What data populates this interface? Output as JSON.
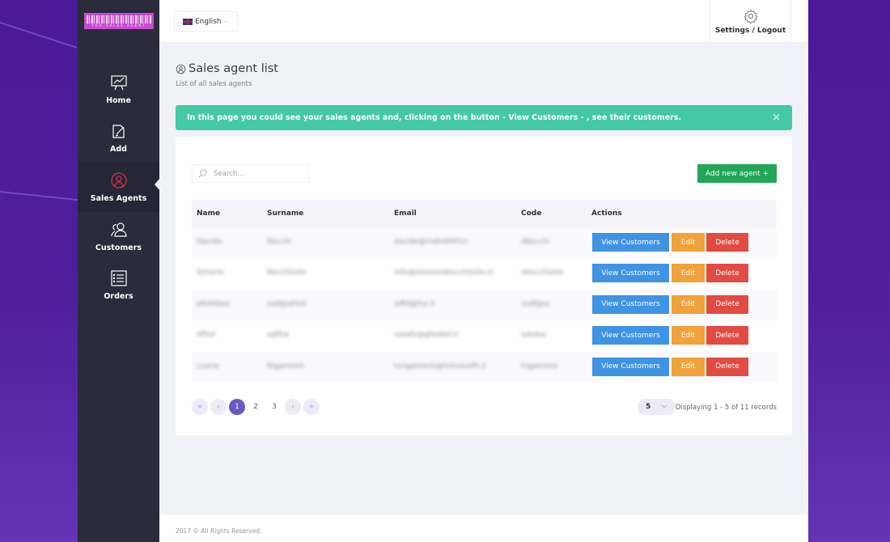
{
  "logo": {
    "text": "YOO SALES AGENT"
  },
  "topbar": {
    "language": "English",
    "settings_label": "Settings / Logout"
  },
  "sidebar": {
    "items": [
      {
        "label": "Home",
        "icon": "presentation-chart-icon",
        "active": false
      },
      {
        "label": "Add",
        "icon": "edit-document-icon",
        "active": false
      },
      {
        "label": "Sales Agents",
        "icon": "agent-globe-icon",
        "active": true
      },
      {
        "label": "Customers",
        "icon": "users-icon",
        "active": false
      },
      {
        "label": "Orders",
        "icon": "list-icon",
        "active": false
      }
    ]
  },
  "page": {
    "title": "Sales agent list",
    "subtitle": "List of all sales agents"
  },
  "alert": {
    "text": "In this page you could see your sales agents and, clicking on the button - View Customers - , see their customers.",
    "close": "×"
  },
  "toolbar": {
    "search_placeholder": "Search...",
    "add_label": "Add new agent +"
  },
  "table": {
    "headers": {
      "name": "Name",
      "surname": "Surname",
      "email": "Email",
      "code": "Code",
      "actions": "Actions"
    },
    "rows": [
      {
        "name": "Davide",
        "surname": "Bocchi",
        "email": "davide@rndm0001n",
        "code": "dbocchi"
      },
      {
        "name": "Simone",
        "surname": "Bocchisola",
        "email": "info@simoneabocchisola.ct",
        "code": "sbocchisola"
      },
      {
        "name": "Jdtdldaso",
        "surname": "sadqsahsd",
        "email": "sdfd@fsa.it",
        "code": "sodfgsa"
      },
      {
        "name": "dffsd",
        "surname": "sqffsa",
        "email": "sasafs@gfeddsf.it",
        "code": "sdsdsa"
      },
      {
        "name": "Luana",
        "surname": "Rigamonti",
        "email": "lurigamonti@tolinosefit.it",
        "code": "lrigamonti"
      }
    ],
    "actions": {
      "view": "View Customers",
      "edit": "Edit",
      "delete": "Delete"
    }
  },
  "pagination": {
    "first": "«",
    "prev": "‹",
    "pages": [
      "1",
      "2",
      "3"
    ],
    "current": "1",
    "next": "›",
    "last": "»",
    "page_size": "5",
    "display": "Displaying 1 - 5 of 11 records"
  },
  "footer": {
    "text": "2017 © All Rights Reserved."
  },
  "colors": {
    "accent": "#6c58c5",
    "success": "#22a657",
    "alert": "#44c8a6",
    "view": "#3f93e3",
    "edit": "#f1a23a",
    "delete": "#e14b42",
    "sidebar": "#2a2b3b"
  }
}
